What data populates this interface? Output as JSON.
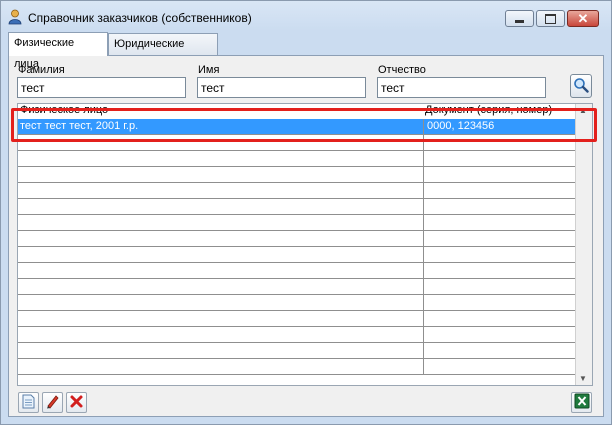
{
  "window": {
    "title": "Справочник заказчиков (собственников)",
    "icons": {
      "app": "user-icon",
      "minimize": "minimize-icon",
      "maximize": "maximize-icon",
      "close": "close-icon"
    }
  },
  "tabs": [
    {
      "label": "Физические лица",
      "active": true
    },
    {
      "label": "Юридические лица",
      "active": false
    }
  ],
  "filters": {
    "surname": {
      "label": "Фамилия",
      "value": "тест"
    },
    "name": {
      "label": "Имя",
      "value": "тест"
    },
    "patronymic": {
      "label": "Отчество",
      "value": "тест"
    },
    "search_icon": "magnifier-icon"
  },
  "grid": {
    "columns": [
      "Физическое лицо",
      "Документ (серия, номер)"
    ],
    "rows": [
      {
        "person": "тест тест тест, 2001 г.р.",
        "document": "0000, 123456",
        "selected": true
      }
    ],
    "empty_rows": 15
  },
  "toolbar": {
    "add_icon": "new-document-icon",
    "edit_icon": "pencil-icon",
    "delete_icon": "delete-icon",
    "export_icon": "excel-icon"
  },
  "colors": {
    "selection": "#3399ff",
    "highlight": "#e3201c"
  }
}
